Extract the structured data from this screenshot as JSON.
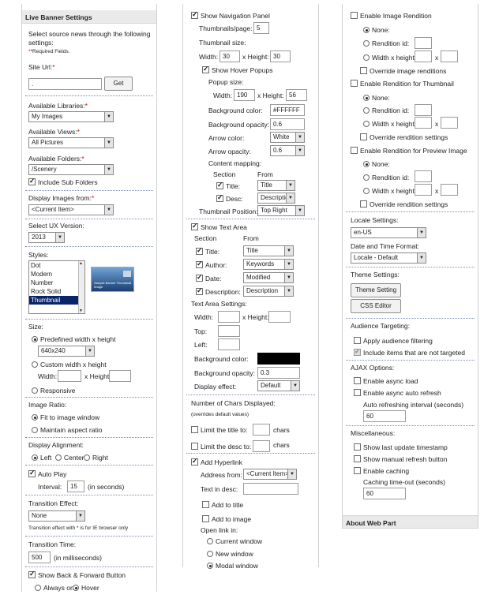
{
  "col1": {
    "title": "Live Banner Settings",
    "intro_line1": "Select source news through the following",
    "intro_line2": "settings:",
    "required_note": "*Required Fields.",
    "site_url": {
      "label": "Site Url:",
      "req": "*",
      "value": ".",
      "button": "Get"
    },
    "libraries": {
      "label": "Available Libraries:",
      "req": "*",
      "value": "My Images"
    },
    "views": {
      "label": "Available Views:",
      "req": "*",
      "value": "All Pictures"
    },
    "folders": {
      "label": "Available Folders:",
      "req": "*",
      "value": "/Scenery",
      "subfolders": "Include Sub Folders"
    },
    "display_from": {
      "label": "Display Images from:",
      "req": "*",
      "value": "<Current Item>"
    },
    "ux_version": {
      "label": "Select UX Version:",
      "value": "2013"
    },
    "styles": {
      "label": "Styles:",
      "items": [
        "Dot",
        "Modern",
        "Number",
        "Rock Solid",
        "Thumbnail"
      ],
      "preview_text": "Sample Banner Thumbnail Image"
    },
    "size": {
      "label": "Size:",
      "predefined": "Predefined width x height",
      "predefined_value": "640x240",
      "custom": "Custom width x height",
      "width": "Width:",
      "height": "x Height:",
      "responsive": "Responsive"
    },
    "image_ratio": {
      "label": "Image Ratio:",
      "fit": "Fit to image window",
      "maintain": "Maintain aspect ratio"
    },
    "alignment": {
      "label": "Display Alignment:",
      "left": "Left",
      "center": "Center",
      "right": "Right"
    },
    "autoplay": {
      "label": "Auto Play",
      "interval": "Interval:",
      "value": "15",
      "unit": "(in seconds)"
    },
    "transition_effect": {
      "label": "Transition Effect:",
      "value": "None",
      "note": "Transition effect with * is for IE browser only"
    },
    "transition_time": {
      "label": "Transition Time:",
      "value": "500",
      "unit": "(in milliseconds)"
    },
    "back_forward": {
      "label": "Show Back & Forward Button",
      "always": "Always on",
      "hover": "Hover"
    }
  },
  "col2": {
    "nav_panel": "Show Navigation Panel",
    "thumbs_per_page": {
      "label": "Thumbnails/page:",
      "value": "5"
    },
    "thumb_size": {
      "label": "Thumbnail size:",
      "width_label": "Width:",
      "width": "30",
      "height_label": "x Height:",
      "height": "30"
    },
    "hover": {
      "label": "Show Hover Popups",
      "popup_size": "Popup size:",
      "width_label": "Width:",
      "width": "190",
      "height_label": "x Height:",
      "height": "56",
      "bg_color_label": "Background color:",
      "bg_color": "#FFFFFF",
      "bg_opacity_label": "Background opacity:",
      "bg_opacity": "0.6",
      "arrow_color_label": "Arrow color:",
      "arrow_color": "White",
      "arrow_opacity_label": "Arrow opacity:",
      "arrow_opacity": "0.6",
      "mapping": "Content mapping:",
      "section": "Section",
      "from": "From",
      "title_label": "Title:",
      "title_value": "Title",
      "desc_label": "Desc:",
      "desc_value": "Description",
      "position_label": "Thumbnail Position:",
      "position_value": "Top Right"
    },
    "text_area": {
      "label": "Show Text Area",
      "section": "Section",
      "from": "From",
      "rows": [
        {
          "label": "Title:",
          "value": "Title"
        },
        {
          "label": "Author:",
          "value": "Keywords"
        },
        {
          "label": "Date:",
          "value": "Modified"
        },
        {
          "label": "Description:",
          "value": "Description"
        }
      ],
      "settings": "Text Area Settings:",
      "width": "Width:",
      "height": "x Height:",
      "top": "Top:",
      "left": "Left:",
      "bg_color": "Background color:",
      "bg_opacity": "Background opacity:",
      "bg_opacity_value": "0.3",
      "effect": "Display effect:",
      "effect_value": "Default"
    },
    "chars": {
      "label": "Number of Chars Displayed:",
      "note": "(overrides default values)",
      "limit_title": "Limit the title to:",
      "limit_desc": "Limit the desc to:",
      "unit": "chars"
    },
    "hyperlink": {
      "label": "Add Hyperlink",
      "address": "Address from:",
      "address_value": "<Current Item>",
      "text_desc": "Text in desc:",
      "add_title": "Add to title",
      "add_image": "Add to image",
      "open_in": "Open link in:",
      "current": "Current window",
      "new": "New window",
      "modal": "Modal window"
    }
  },
  "col3": {
    "image_rendition": "Enable Image Rendition",
    "thumb_rendition": "Enable Rendition for Thumbnail",
    "preview_rendition": "Enable Rendition for Preview Image",
    "none": "None:",
    "rendition_id": "Rendition id:",
    "wh": "Width x height:",
    "override_image": "Override image renditions",
    "override_rendition": "Override rendition settings",
    "locale": {
      "label": "Locale Settings:",
      "value": "en-US"
    },
    "datetime": {
      "label": "Date and Time Format:",
      "value": "Locale - Default"
    },
    "theme": {
      "label": "Theme Settings:",
      "setting_btn": "Theme Setting",
      "css_btn": "CSS Editor"
    },
    "audience": {
      "label": "Audience Targeting:",
      "apply": "Apply audience filtering",
      "include": "Include items that are not targeted"
    },
    "ajax": {
      "label": "AJAX Options:",
      "async": "Enable async load",
      "auto_refresh": "Enable async auto refresh",
      "interval_label": "Auto refreshing interval (seconds)",
      "interval": "60"
    },
    "misc": {
      "label": "Miscellaneous:",
      "timestamp": "Show last update timestamp",
      "manual": "Show manual refresh button",
      "caching": "Enable caching",
      "cache_label": "Caching time-out (seconds)",
      "cache": "60"
    },
    "about": "About Web Part"
  }
}
